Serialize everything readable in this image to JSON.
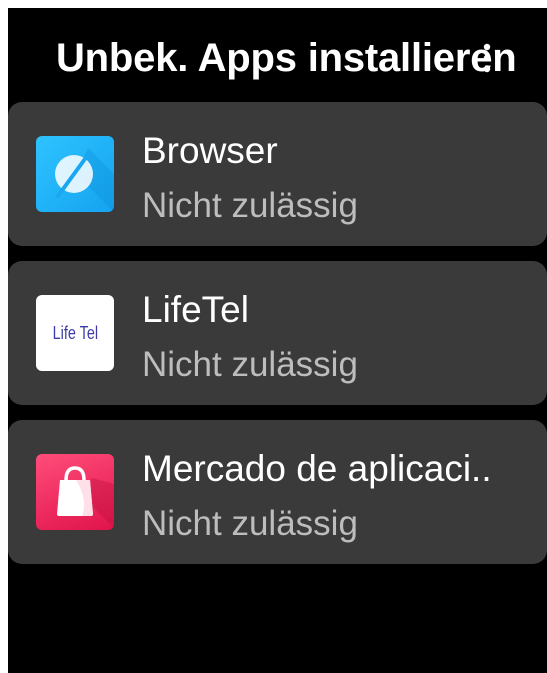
{
  "header": {
    "title": "Unbek. Apps installieren",
    "menu_icon": "more-vert-icon"
  },
  "apps": [
    {
      "name": "Browser",
      "status": "Nicht zulässig",
      "icon": "browser-icon",
      "icon_color": "#14a3f0"
    },
    {
      "name": "LifeTel",
      "status": "Nicht zulässig",
      "icon": "lifetel-icon",
      "icon_text": "Life Tel",
      "icon_color": "#3d3aa8"
    },
    {
      "name": "Mercado de aplicaci..",
      "status": "Nicht zulässig",
      "icon": "shopping-bag-icon",
      "icon_color": "#e0134a"
    }
  ],
  "colors": {
    "background": "#000000",
    "card": "#3a3a3a",
    "primary_text": "#ffffff",
    "secondary_text": "#bdbdbd"
  }
}
